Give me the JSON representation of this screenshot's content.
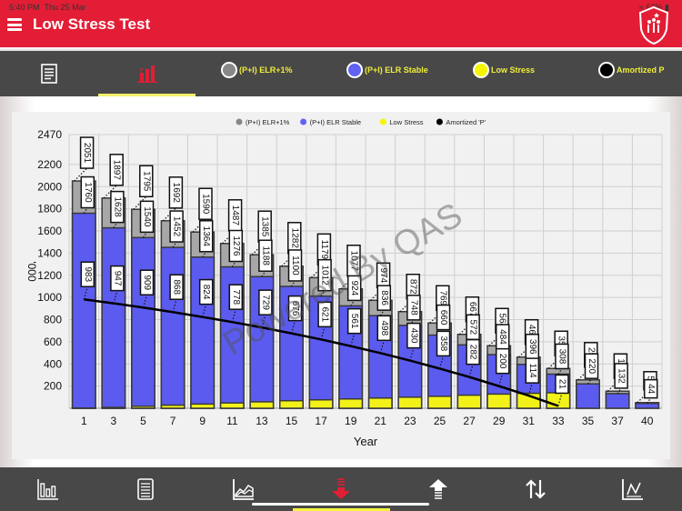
{
  "status_bar": {
    "time": "5:40 PM",
    "date": "Thu 25 Mar",
    "battery": "67%"
  },
  "header": {
    "title": "Low Stress Test",
    "menu_icon": "hamburger-icon",
    "logo_icon": "shield-family-logo"
  },
  "tabs": [
    {
      "icon": "document-icon",
      "active": false
    },
    {
      "icon": "bar-chart-icon",
      "active": true
    }
  ],
  "legend_tabs": [
    {
      "label": "(P+I) ELR+1%",
      "color": "#888888"
    },
    {
      "label": "(P+I) ELR Stable",
      "color": "#6161f2"
    },
    {
      "label": "Low Stress",
      "color": "#f5f500"
    },
    {
      "label": "Amortized P",
      "color": "#000000"
    }
  ],
  "colors": {
    "header_red": "#e31d35",
    "bar_gray": "#a7a7a7",
    "bar_blue": "#5b5bef",
    "bar_yellow": "#f2f21a",
    "line_black": "#000000",
    "tab_highlight": "#f2f06a"
  },
  "watermark": "Powered By QAS",
  "chart_data": {
    "type": "bar",
    "title": "",
    "xlabel": "Year",
    "ylabel": "'000",
    "ylim": [
      0,
      2470
    ],
    "yticks": [
      200,
      400,
      600,
      800,
      1000,
      1200,
      1400,
      1600,
      1800,
      2000,
      2200,
      2470
    ],
    "categories": [
      "1",
      "3",
      "5",
      "7",
      "9",
      "11",
      "13",
      "15",
      "17",
      "19",
      "21",
      "23",
      "25",
      "27",
      "29",
      "31",
      "33",
      "35",
      "37",
      "40"
    ],
    "legend": [
      "(P+I) ELR+1%",
      "(P+I) ELR Stable",
      "Low Stress",
      "Amortized 'P'"
    ],
    "legend_position": "top",
    "grid": true,
    "series": [
      {
        "name": "(P+I) ELR+1%",
        "type": "bar",
        "values": [
          2051,
          1897,
          1795,
          1692,
          1590,
          1487,
          1385,
          1282,
          1179,
          1077,
          974,
          872,
          769,
          667,
          564,
          462,
          359,
          256,
          154,
          51
        ]
      },
      {
        "name": "(P+I) ELR Stable",
        "type": "bar",
        "values": [
          1760,
          1628,
          1540,
          1452,
          1364,
          1276,
          1188,
          1100,
          1012,
          924,
          836,
          748,
          660,
          572,
          484,
          396,
          308,
          220,
          132,
          44
        ]
      },
      {
        "name": "Low Stress",
        "type": "bar",
        "values": [
          2,
          8,
          18,
          28,
          38,
          48,
          58,
          68,
          76,
          84,
          92,
          100,
          108,
          118,
          128,
          135,
          140,
          0,
          0,
          0
        ]
      },
      {
        "name": "Amortized 'P'",
        "type": "line",
        "values": [
          983,
          947,
          909,
          868,
          824,
          778,
          729,
          676,
          621,
          561,
          498,
          430,
          358,
          282,
          200,
          114,
          21,
          null,
          null,
          null
        ]
      }
    ]
  },
  "bottom_nav": [
    {
      "icon": "bar-chart-icon",
      "active": false
    },
    {
      "icon": "document-icon",
      "active": false
    },
    {
      "icon": "area-chart-icon",
      "active": false
    },
    {
      "icon": "arrow-down-icon",
      "active": true
    },
    {
      "icon": "arrow-up-icon",
      "active": false
    },
    {
      "icon": "swap-vertical-icon",
      "active": false
    },
    {
      "icon": "line-chart-icon",
      "active": false
    }
  ]
}
